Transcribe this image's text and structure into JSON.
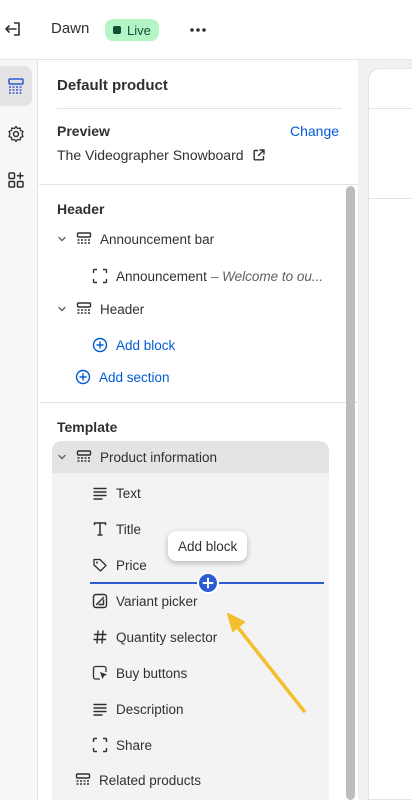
{
  "topbar": {
    "theme_name": "Dawn",
    "status_label": "Live"
  },
  "panel": {
    "title": "Default product",
    "preview_label": "Preview",
    "change_label": "Change",
    "product_name": "The Videographer Snowboard"
  },
  "header_section": {
    "heading": "Header",
    "announcement_bar": "Announcement bar",
    "announcement_block": "Announcement",
    "announcement_sub": "– Welcome to ou...",
    "header_item": "Header",
    "add_block": "Add block",
    "add_section": "Add section"
  },
  "template_section": {
    "heading": "Template",
    "product_information": "Product information",
    "blocks": [
      "Text",
      "Title",
      "Price",
      "Variant picker",
      "Quantity selector",
      "Buy buttons",
      "Description",
      "Share"
    ],
    "related_products": "Related products"
  },
  "tooltip": {
    "label": "Add block"
  },
  "colors": {
    "accent": "#005bd3",
    "live_badge": "#b3f5c5",
    "arrow": "#f2c02c"
  }
}
